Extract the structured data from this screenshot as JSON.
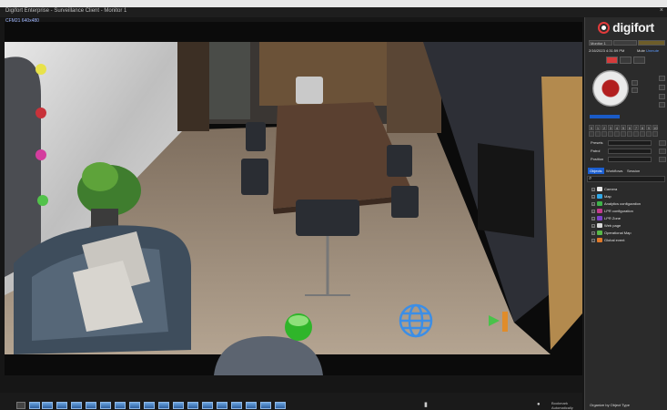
{
  "window": {
    "title": "Digifort Enterprise - Surveillance Client - Monitor 1",
    "controls": "×"
  },
  "video": {
    "camera_label": "CFM21 640x480"
  },
  "logo": {
    "text": "digifort"
  },
  "panel": {
    "tabs": [
      "Monitor 1",
      "",
      ""
    ],
    "datetime": "2/16/2023 4:31:59 PM",
    "mute_label": "Mute",
    "mute_value": "Unmute",
    "ptz_grid": {
      "row1": [
        "0",
        "1",
        "2",
        "3",
        "4",
        "5",
        "6",
        "7",
        "8",
        "9",
        "10"
      ],
      "row2": [
        "",
        "",
        "",
        "",
        "",
        "",
        "",
        "",
        "",
        "",
        ""
      ]
    },
    "fields": {
      "presets": "Presets",
      "patrol": "Patrol",
      "position": "Position"
    },
    "object_tabs": [
      "Objects",
      "Workflows",
      "Session"
    ],
    "tree": [
      {
        "label": "Camera",
        "color": "#e8e8e8"
      },
      {
        "label": "Map",
        "color": "#31a8e8"
      },
      {
        "label": "Analytics configuration",
        "color": "#3fb24a"
      },
      {
        "label": "LPR configuration",
        "color": "#c23b8d"
      },
      {
        "label": "LPR Zone",
        "color": "#7d43c9"
      },
      {
        "label": "Web page",
        "color": "#d9d9d9"
      },
      {
        "label": "Operational Map",
        "color": "#58b848"
      },
      {
        "label": "Global event",
        "color": "#e07a2a"
      }
    ],
    "organize": "Organize by Object Type"
  },
  "bottombar": {
    "thumb_count": "17",
    "label_left": "",
    "label_right1": "Bookmark",
    "label_right2": "Automatically"
  },
  "colors": {
    "accent": "#1c5fd0",
    "record_red": "#d63b3b"
  }
}
